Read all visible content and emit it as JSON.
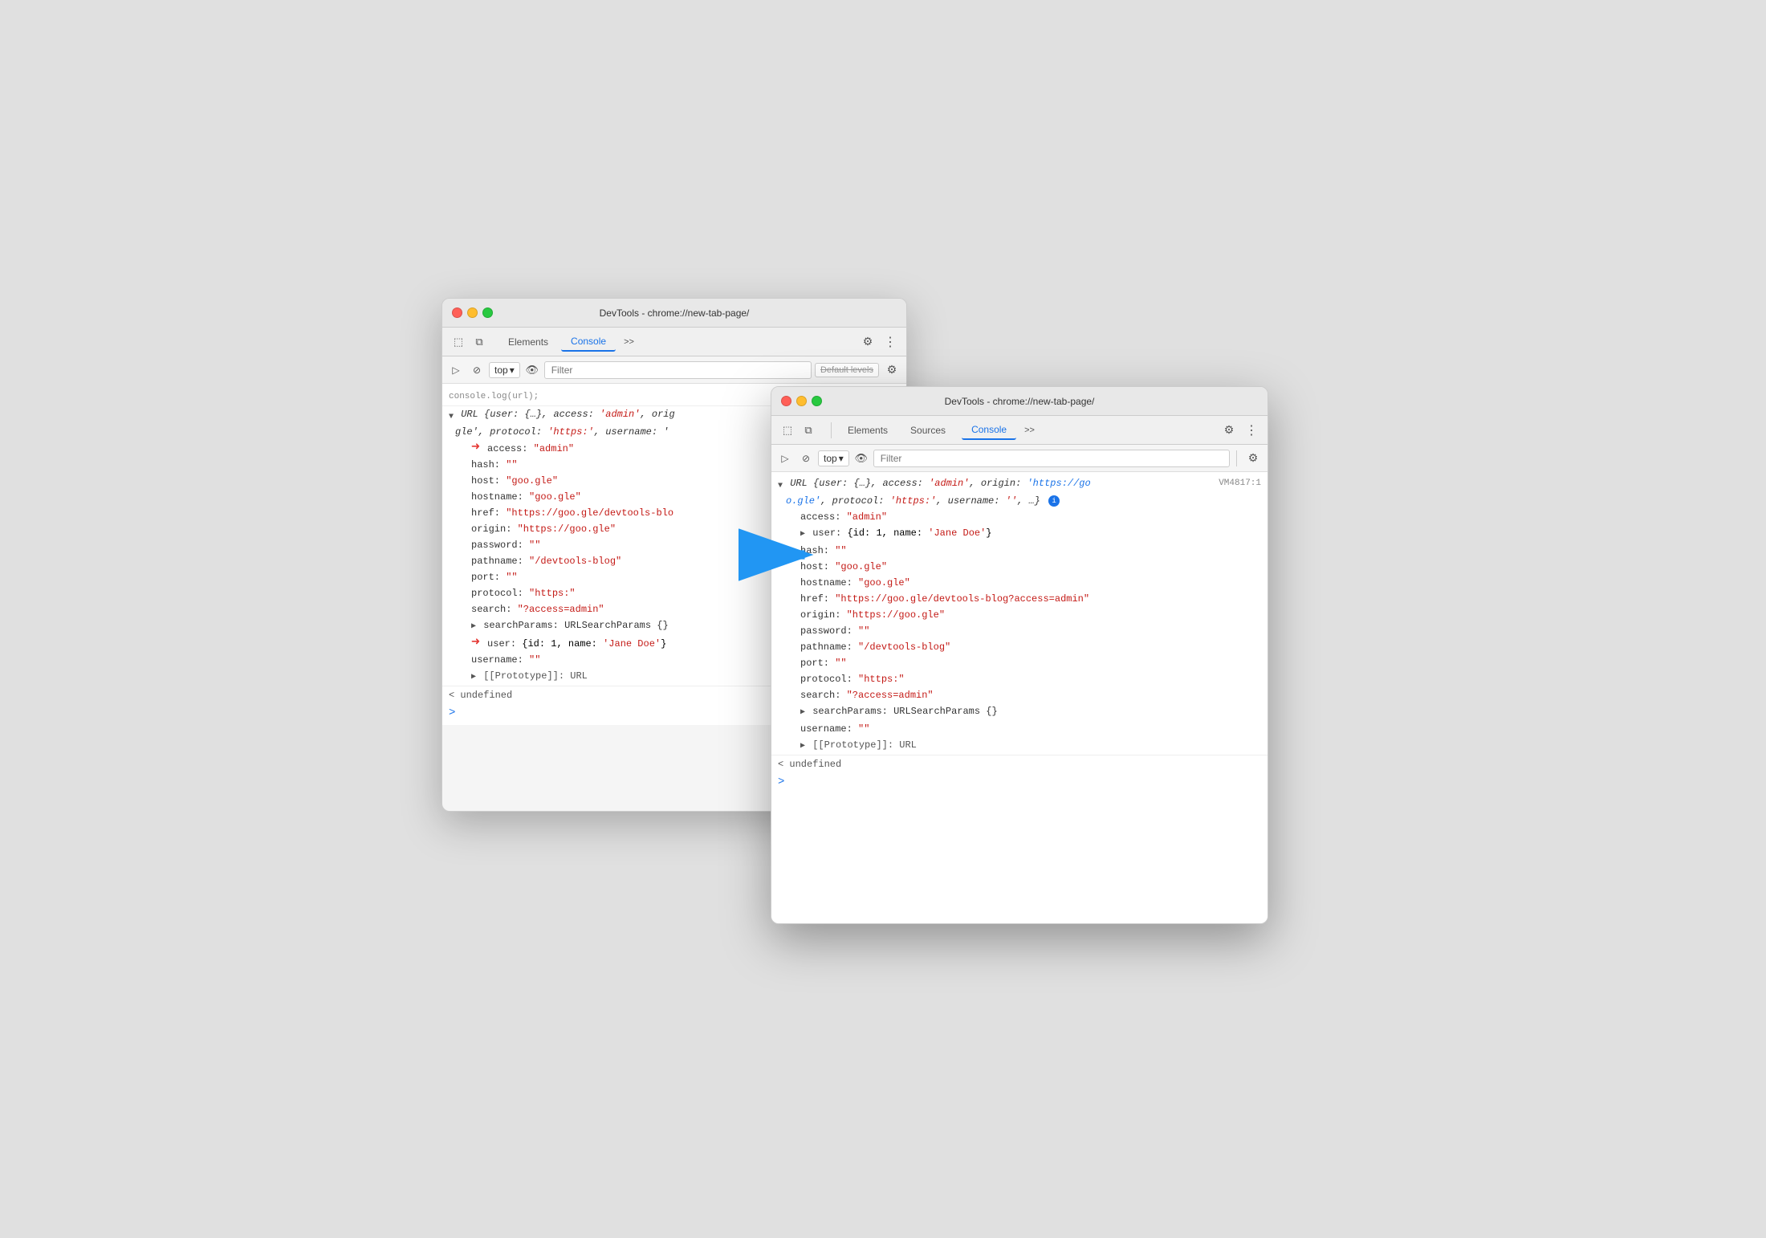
{
  "scene": {
    "background_color": "#e8e8e8"
  },
  "window_back": {
    "title": "DevTools - chrome://new-tab-page/",
    "tabs": {
      "elements": "Elements",
      "console": "Console",
      "more": ">>"
    },
    "toolbar": {
      "top_label": "top",
      "filter_placeholder": "Filter",
      "default_levels": "Default levels"
    },
    "console_log": {
      "truncated_line": "console.log(url)",
      "url_obj_line": "▼ URL {user: {…}, access: 'admin', orig",
      "url_cont": "gle', protocol: 'https:', username: '",
      "access_val": "access: \"admin\"",
      "hash_val": "hash: \"\"",
      "host_val": "host: \"goo.gle\"",
      "hostname_val": "hostname: \"goo.gle\"",
      "href_val": "href: \"https://goo.gle/devtools-blo",
      "origin_val": "origin: \"https://goo.gle\"",
      "password_val": "password: \"\"",
      "pathname_val": "pathname: \"/devtools-blog\"",
      "port_val": "port: \"\"",
      "protocol_val": "protocol: \"https:\"",
      "search_val": "search: \"?access=admin\"",
      "searchparams_val": "searchParams: URLSearchParams {}",
      "user_val": "user: {id: 1, name: 'Jane Doe'}",
      "username_val": "username: \"\"",
      "prototype_val": "[[Prototype]]: URL",
      "undefined_val": "< undefined",
      "prompt": ">"
    }
  },
  "window_front": {
    "title": "DevTools - chrome://new-tab-page/",
    "tabs": {
      "elements": "Elements",
      "sources": "Sources",
      "console": "Console",
      "more": ">>"
    },
    "toolbar": {
      "top_label": "top",
      "filter_placeholder": "Filter"
    },
    "vm_badge": "VM4817:1",
    "console_log": {
      "url_obj_line": "▼ URL {user: {…}, access: 'admin', origin: 'https://go",
      "url_obj_line2": "o.gle', protocol: 'https:', username: '', …}",
      "access_val": "access: \"admin\"",
      "user_val": "▶ user: {id: 1, name: 'Jane Doe'}",
      "hash_val": "hash: \"\"",
      "host_val": "host: \"goo.gle\"",
      "hostname_val": "hostname: \"goo.gle\"",
      "href_val": "href: \"https://goo.gle/devtools-blog?access=admin\"",
      "origin_val": "origin: \"https://goo.gle\"",
      "password_val": "password: \"\"",
      "pathname_val": "pathname: \"/devtools-blog\"",
      "port_val": "port: \"\"",
      "protocol_val": "protocol: \"https:\"",
      "search_val": "search: \"?access=admin\"",
      "searchparams_val": "▶ searchParams: URLSearchParams {}",
      "username_val": "username: \"\"",
      "prototype_val": "▶ [[Prototype]]: URL",
      "undefined_val": "< undefined",
      "prompt": ">"
    }
  },
  "icons": {
    "cursor": "⬚",
    "layers": "⧉",
    "ban": "⊘",
    "eye": "👁",
    "gear": "⚙",
    "more_vert": "⋮",
    "info": "i",
    "arrow_right": "▶",
    "arrow_down": "▼",
    "red_arrow": "➜"
  }
}
